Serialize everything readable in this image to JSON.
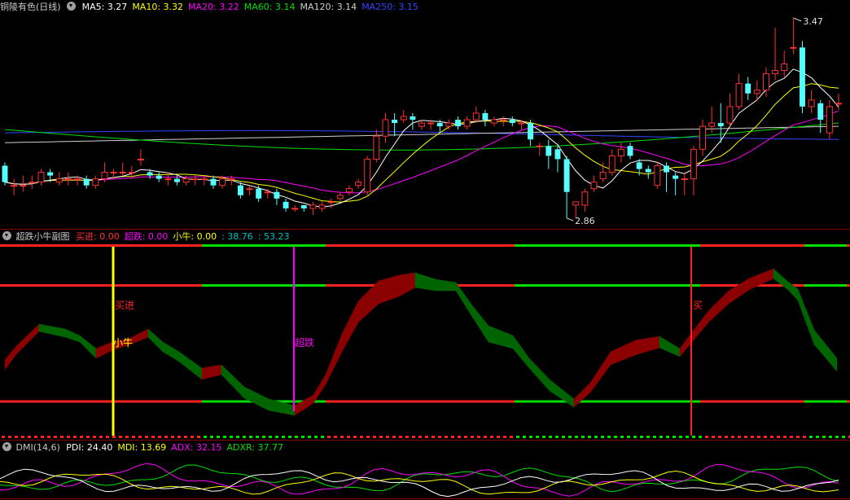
{
  "main_panel": {
    "stock_title": "铜陵有色(日线)",
    "ma_labels": [
      {
        "name": "MA5",
        "value": "3.27",
        "color": "#ffffff"
      },
      {
        "name": "MA10",
        "value": "3.32",
        "color": "#ffff00"
      },
      {
        "name": "MA20",
        "value": "3.22",
        "color": "#ff00ff"
      },
      {
        "name": "MA60",
        "value": "3.14",
        "color": "#00e000"
      },
      {
        "name": "MA120",
        "value": "3.14",
        "color": "#cfcfcf"
      },
      {
        "name": "MA250",
        "value": "3.15",
        "color": "#3344ff"
      }
    ],
    "high_label": "3.47",
    "low_label": "2.86"
  },
  "sub_panel": {
    "title": "超跌小牛副图",
    "labels": [
      {
        "text": "买进: 0.00",
        "color": "#ff3030"
      },
      {
        "text": "超跌: 0.00",
        "color": "#ff00ff"
      },
      {
        "text": "小牛: 0.00",
        "color": "#ffff00"
      },
      {
        "text": ": 38.76",
        "color": "#00c0c0"
      },
      {
        "text": ": 53.23",
        "color": "#00c0c0"
      }
    ],
    "annotations": {
      "buy": "买进",
      "xiaoniu": "小牛",
      "chaodie": "超跌",
      "buy_partial": "买"
    }
  },
  "dmi_panel": {
    "title": "DMI(14,6)",
    "labels": [
      {
        "text": "PDI: 24.40",
        "color": "#ffffff"
      },
      {
        "text": "MDI: 13.69",
        "color": "#ffff00"
      },
      {
        "text": "ADX: 32.15",
        "color": "#ff00ff"
      },
      {
        "text": "ADXR: 37.77",
        "color": "#00e000"
      }
    ]
  },
  "colors": {
    "up": "#ff3030",
    "down": "#54ffff",
    "bull_band": "#8b0000",
    "bear_band": "#006400",
    "green": "#00e000"
  },
  "chart_data": {
    "type": "candlestick",
    "y_range": [
      2.86,
      3.47
    ],
    "candles": [
      {
        "o": 3.02,
        "c": 2.97,
        "h": 3.03,
        "l": 2.96
      },
      {
        "o": 2.96,
        "c": 2.96,
        "h": 2.98,
        "l": 2.93
      },
      {
        "o": 2.96,
        "c": 2.96,
        "h": 2.99,
        "l": 2.94
      },
      {
        "o": 2.97,
        "c": 2.97,
        "h": 2.99,
        "l": 2.95
      },
      {
        "o": 2.97,
        "c": 3.0,
        "h": 3.01,
        "l": 2.96
      },
      {
        "o": 3.0,
        "c": 2.99,
        "h": 3.01,
        "l": 2.97
      },
      {
        "o": 2.97,
        "c": 2.98,
        "h": 3.0,
        "l": 2.96
      },
      {
        "o": 2.98,
        "c": 2.98,
        "h": 3.0,
        "l": 2.96
      },
      {
        "o": 2.98,
        "c": 2.98,
        "h": 2.99,
        "l": 2.96
      },
      {
        "o": 2.98,
        "c": 2.96,
        "h": 2.99,
        "l": 2.95
      },
      {
        "o": 2.96,
        "c": 2.98,
        "h": 2.99,
        "l": 2.95
      },
      {
        "o": 2.98,
        "c": 3.0,
        "h": 3.03,
        "l": 2.97
      },
      {
        "o": 3.0,
        "c": 3.0,
        "h": 3.01,
        "l": 2.98
      },
      {
        "o": 3.0,
        "c": 3.0,
        "h": 3.03,
        "l": 2.99
      },
      {
        "o": 3.0,
        "c": 3.0,
        "h": 3.02,
        "l": 2.98
      },
      {
        "o": 3.04,
        "c": 3.04,
        "h": 3.07,
        "l": 3.02
      },
      {
        "o": 3.0,
        "c": 2.99,
        "h": 3.01,
        "l": 2.98
      },
      {
        "o": 2.99,
        "c": 2.98,
        "h": 3.0,
        "l": 2.97
      },
      {
        "o": 2.98,
        "c": 2.98,
        "h": 3.0,
        "l": 2.96
      },
      {
        "o": 2.98,
        "c": 2.97,
        "h": 2.99,
        "l": 2.96
      },
      {
        "o": 2.97,
        "c": 2.98,
        "h": 2.99,
        "l": 2.96
      },
      {
        "o": 2.98,
        "c": 2.98,
        "h": 2.99,
        "l": 2.96
      },
      {
        "o": 2.98,
        "c": 2.98,
        "h": 2.99,
        "l": 2.96
      },
      {
        "o": 2.98,
        "c": 2.96,
        "h": 2.99,
        "l": 2.95
      },
      {
        "o": 2.96,
        "c": 2.98,
        "h": 2.99,
        "l": 2.95
      },
      {
        "o": 2.98,
        "c": 2.98,
        "h": 2.99,
        "l": 2.96
      },
      {
        "o": 2.96,
        "c": 2.93,
        "h": 2.97,
        "l": 2.92
      },
      {
        "o": 2.95,
        "c": 2.95,
        "h": 2.96,
        "l": 2.93
      },
      {
        "o": 2.95,
        "c": 2.92,
        "h": 2.96,
        "l": 2.91
      },
      {
        "o": 2.94,
        "c": 2.94,
        "h": 2.95,
        "l": 2.92
      },
      {
        "o": 2.94,
        "c": 2.92,
        "h": 2.95,
        "l": 2.9
      },
      {
        "o": 2.91,
        "c": 2.89,
        "h": 2.92,
        "l": 2.88
      },
      {
        "o": 2.89,
        "c": 2.89,
        "h": 2.9,
        "l": 2.88
      },
      {
        "o": 2.9,
        "c": 2.89,
        "h": 2.9,
        "l": 2.88
      },
      {
        "o": 2.89,
        "c": 2.9,
        "h": 2.91,
        "l": 2.87
      },
      {
        "o": 2.89,
        "c": 2.9,
        "h": 2.91,
        "l": 2.88
      },
      {
        "o": 2.91,
        "c": 2.91,
        "h": 2.92,
        "l": 2.89
      },
      {
        "o": 2.92,
        "c": 2.93,
        "h": 2.94,
        "l": 2.91
      },
      {
        "o": 2.94,
        "c": 2.95,
        "h": 2.96,
        "l": 2.93
      },
      {
        "o": 2.96,
        "c": 2.97,
        "h": 2.98,
        "l": 2.95
      },
      {
        "o": 2.94,
        "c": 3.04,
        "h": 3.05,
        "l": 2.93
      },
      {
        "o": 3.04,
        "c": 3.11,
        "h": 3.13,
        "l": 3.03
      },
      {
        "o": 3.11,
        "c": 3.16,
        "h": 3.18,
        "l": 3.09
      },
      {
        "o": 3.16,
        "c": 3.15,
        "h": 3.18,
        "l": 3.11
      },
      {
        "o": 3.16,
        "c": 3.17,
        "h": 3.19,
        "l": 3.15
      },
      {
        "o": 3.17,
        "c": 3.16,
        "h": 3.18,
        "l": 3.13
      },
      {
        "o": 3.14,
        "c": 3.15,
        "h": 3.16,
        "l": 3.13
      },
      {
        "o": 3.15,
        "c": 3.15,
        "h": 3.16,
        "l": 3.13
      },
      {
        "o": 3.15,
        "c": 3.14,
        "h": 3.16,
        "l": 3.12
      },
      {
        "o": 3.14,
        "c": 3.15,
        "h": 3.16,
        "l": 3.13
      },
      {
        "o": 3.16,
        "c": 3.14,
        "h": 3.17,
        "l": 3.13
      },
      {
        "o": 3.14,
        "c": 3.16,
        "h": 3.17,
        "l": 3.13
      },
      {
        "o": 3.16,
        "c": 3.18,
        "h": 3.2,
        "l": 3.15
      },
      {
        "o": 3.18,
        "c": 3.16,
        "h": 3.19,
        "l": 3.14
      },
      {
        "o": 3.15,
        "c": 3.16,
        "h": 3.17,
        "l": 3.14
      },
      {
        "o": 3.16,
        "c": 3.16,
        "h": 3.17,
        "l": 3.14
      },
      {
        "o": 3.16,
        "c": 3.15,
        "h": 3.17,
        "l": 3.14
      },
      {
        "o": 3.15,
        "c": 3.15,
        "h": 3.16,
        "l": 3.13
      },
      {
        "o": 3.15,
        "c": 3.1,
        "h": 3.16,
        "l": 3.08
      },
      {
        "o": 3.08,
        "c": 3.08,
        "h": 3.09,
        "l": 3.05
      },
      {
        "o": 3.08,
        "c": 3.05,
        "h": 3.1,
        "l": 3.01
      },
      {
        "o": 3.07,
        "c": 3.04,
        "h": 3.08,
        "l": 3.0
      },
      {
        "o": 3.04,
        "c": 2.94,
        "h": 3.05,
        "l": 2.86
      },
      {
        "o": 2.9,
        "c": 2.91,
        "h": 2.91,
        "l": 2.86
      },
      {
        "o": 2.9,
        "c": 2.94,
        "h": 2.95,
        "l": 2.88
      },
      {
        "o": 2.95,
        "c": 2.97,
        "h": 2.99,
        "l": 2.94
      },
      {
        "o": 2.98,
        "c": 3.0,
        "h": 3.03,
        "l": 2.97
      },
      {
        "o": 3.0,
        "c": 3.05,
        "h": 3.07,
        "l": 2.99
      },
      {
        "o": 3.05,
        "c": 3.07,
        "h": 3.09,
        "l": 3.03
      },
      {
        "o": 3.08,
        "c": 3.05,
        "h": 3.09,
        "l": 3.04
      },
      {
        "o": 3.03,
        "c": 3.01,
        "h": 3.04,
        "l": 2.99
      },
      {
        "o": 3.01,
        "c": 3.0,
        "h": 3.02,
        "l": 2.98
      },
      {
        "o": 2.96,
        "c": 3.02,
        "h": 3.03,
        "l": 2.95
      },
      {
        "o": 3.02,
        "c": 3.0,
        "h": 3.03,
        "l": 2.94
      },
      {
        "o": 2.99,
        "c": 2.98,
        "h": 3.0,
        "l": 2.93
      },
      {
        "o": 2.98,
        "c": 2.98,
        "h": 3.0,
        "l": 2.93
      },
      {
        "o": 2.98,
        "c": 3.07,
        "h": 3.08,
        "l": 2.93
      },
      {
        "o": 3.07,
        "c": 3.14,
        "h": 3.16,
        "l": 3.05
      },
      {
        "o": 3.14,
        "c": 3.15,
        "h": 3.2,
        "l": 3.12
      },
      {
        "o": 3.15,
        "c": 3.14,
        "h": 3.21,
        "l": 3.09
      },
      {
        "o": 3.15,
        "c": 3.2,
        "h": 3.24,
        "l": 3.14
      },
      {
        "o": 3.2,
        "c": 3.27,
        "h": 3.3,
        "l": 3.19
      },
      {
        "o": 3.27,
        "c": 3.24,
        "h": 3.29,
        "l": 3.22
      },
      {
        "o": 3.24,
        "c": 3.25,
        "h": 3.28,
        "l": 3.22
      },
      {
        "o": 3.25,
        "c": 3.3,
        "h": 3.32,
        "l": 3.23
      },
      {
        "o": 3.3,
        "c": 3.31,
        "h": 3.44,
        "l": 3.28
      },
      {
        "o": 3.31,
        "c": 3.33,
        "h": 3.37,
        "l": 3.29
      },
      {
        "o": 3.38,
        "c": 3.38,
        "h": 3.47,
        "l": 3.36
      },
      {
        "o": 3.38,
        "c": 3.2,
        "h": 3.4,
        "l": 3.18
      },
      {
        "o": 3.2,
        "c": 3.22,
        "h": 3.25,
        "l": 3.18
      },
      {
        "o": 3.21,
        "c": 3.16,
        "h": 3.22,
        "l": 3.12
      },
      {
        "o": 3.12,
        "c": 3.2,
        "h": 3.22,
        "l": 3.1
      },
      {
        "o": 3.21,
        "c": 3.21,
        "h": 3.24,
        "l": 3.19
      }
    ]
  }
}
